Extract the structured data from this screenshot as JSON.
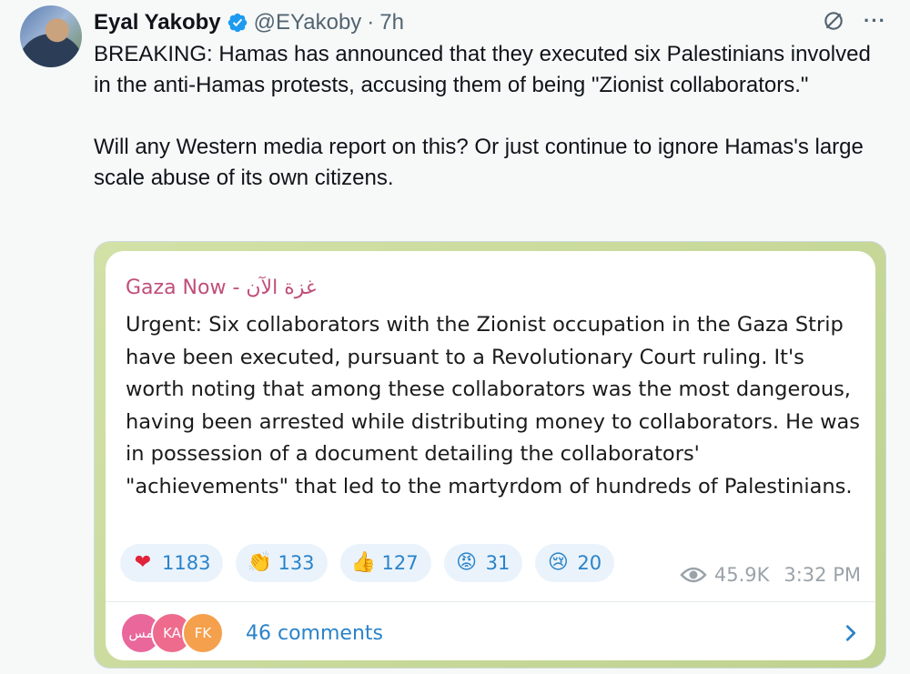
{
  "tweet": {
    "author_name": "Eyal Yakoby",
    "handle": "@EYakoby",
    "separator": "·",
    "time": "7h",
    "more_label": "···",
    "text": "BREAKING: Hamas has announced that they executed six Palestinians involved in the anti-Hamas protests, accusing them of being \"Zionist collaborators.\"\n\nWill any Western media report on this? Or just continue to ignore Hamas's large scale abuse of its own citizens."
  },
  "telegram_post": {
    "channel": "Gaza Now - غزة الآن",
    "message": "Urgent: Six collaborators with the Zionist occupation in the Gaza Strip have been executed, pursuant to a Revolutionary Court ruling. It's worth noting that among these collaborators was the most dangerous, having been arrested while distributing money to collaborators. He was in possession of a document detailing the collaborators' \"achievements\" that led to the martyrdom of hundreds of Palestinians.",
    "reactions": [
      {
        "icon": "red-heart-icon",
        "glyph": "❤",
        "count": "1183"
      },
      {
        "icon": "clapping-hands-icon",
        "glyph": "👏",
        "count": "133"
      },
      {
        "icon": "thumbs-up-icon",
        "glyph": "👍",
        "count": "127"
      },
      {
        "icon": "angry-face-icon",
        "glyph": "😡",
        "count": "31"
      },
      {
        "icon": "crying-face-icon",
        "glyph": "😢",
        "count": "20"
      }
    ],
    "views": "45.9K",
    "post_time": "3:32 PM",
    "commenters": [
      "مس",
      "KA",
      "FK"
    ],
    "comments_label": "46 comments"
  },
  "colors": {
    "verified_blue": "#1d9bf0",
    "telegram_link_blue": "#2a83c9",
    "channel_pink": "#c04e7a",
    "telegram_bg_green": "#c8d99e"
  }
}
